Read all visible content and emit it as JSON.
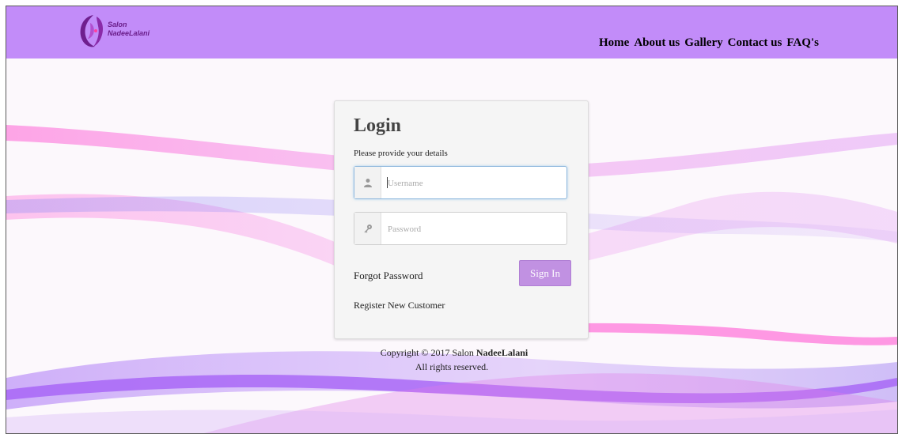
{
  "navbar": {
    "background": "#c28cf9",
    "logo": {
      "line1": "Salon",
      "line2": "NadeeLalani"
    },
    "links": [
      {
        "label": "Home"
      },
      {
        "label": "About us"
      },
      {
        "label": "Gallery"
      },
      {
        "label": "Contact us"
      },
      {
        "label": "FAQ's"
      }
    ]
  },
  "login": {
    "title": "Login",
    "subtitle": "Please provide your details",
    "username": {
      "placeholder": "Username",
      "value": "",
      "icon": "user-icon"
    },
    "password": {
      "placeholder": "Password",
      "value": "",
      "icon": "key-icon"
    },
    "forgot_label": "Forgot Password",
    "signin_label": "Sign In",
    "register_label": "Register New Customer",
    "button_color": "#c191e2"
  },
  "footer": {
    "copyright_prefix": "Copyright © 2017 Salon",
    "brand": "NadeeLalani",
    "rights": "All rights reserved."
  }
}
